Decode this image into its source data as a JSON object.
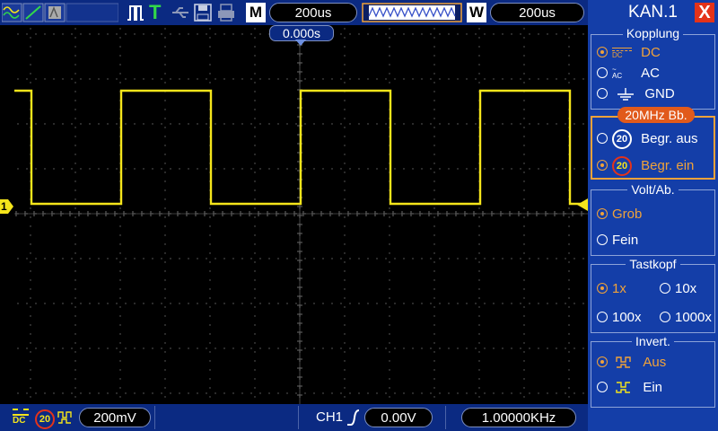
{
  "topbar": {
    "mode_label": "M",
    "timebase": "200us",
    "window_label": "W",
    "window_timebase": "200us",
    "trigger_marker": "T"
  },
  "screen": {
    "trigger_position": "0.000s",
    "channel_marker": "1",
    "trace_color": "#f5e51b",
    "grid_color": "#6b6b6b"
  },
  "bottombar": {
    "ch1_scale": "200mV",
    "bw_badge": "20",
    "trigger_source": "CH1",
    "trigger_level": "0.00V",
    "frequency": "1.00000KHz"
  },
  "panel": {
    "title": "KAN.1",
    "close": "X",
    "coupling": {
      "title": "Kopplung",
      "dc_icon": "DC",
      "ac_icon": "AC",
      "dc": "DC",
      "ac": "AC",
      "gnd": "GND"
    },
    "bandwidth": {
      "title": "20MHz  Bb.",
      "badge": "20",
      "off": "Begr.  aus",
      "on": "Begr.  ein"
    },
    "volts": {
      "title": "Volt/Ab.",
      "coarse": "Grob",
      "fine": "Fein"
    },
    "probe": {
      "title": "Tastkopf",
      "x1": "1x",
      "x10": "10x",
      "x100": "100x",
      "x1000": "1000x"
    },
    "invert": {
      "title": "Invert.",
      "off": "Aus",
      "on": "Ein"
    }
  },
  "colors": {
    "accent_orange": "#f0a23a",
    "panel_blue": "#143ea8",
    "bar_blue": "#0b2a82",
    "close_red": "#e4331a"
  }
}
